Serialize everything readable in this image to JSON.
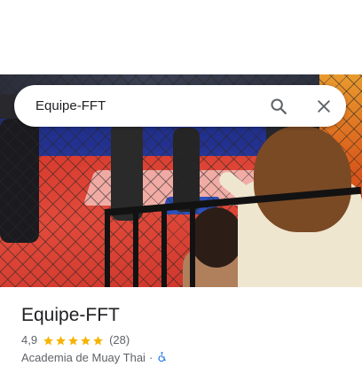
{
  "search": {
    "query": "Equipe-FFT"
  },
  "icons": {
    "search": "search-icon",
    "close": "close-icon",
    "accessibility": "wheelchair-accessible-icon",
    "star": "star-icon"
  },
  "place": {
    "name": "Equipe-FFT",
    "rating": "4,9",
    "stars": 5,
    "review_count": "(28)",
    "category": "Academia de Muay Thai",
    "separator": "·"
  },
  "colors": {
    "star": "#f6b400",
    "accessibility": "#1a73e8",
    "title": "#202124",
    "secondary": "#5f6368"
  }
}
